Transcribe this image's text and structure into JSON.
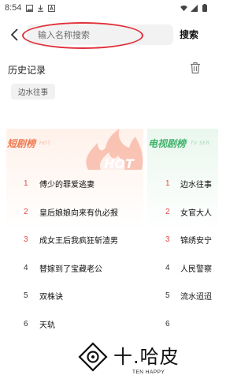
{
  "status_bar": {
    "time": "8:54",
    "icons": [
      "image-icon",
      "download-icon",
      "font-icon",
      "wifi-icon",
      "signal-icon",
      "battery-icon"
    ]
  },
  "search": {
    "placeholder": "输入名称搜索",
    "button_label": "搜索",
    "annotation_color": "#e0303a"
  },
  "history": {
    "title": "历史记录",
    "items": [
      "边水往事"
    ]
  },
  "short_drama_ranking": {
    "title": "短剧榜",
    "subtitle": "HOT",
    "deco_text": "HOT",
    "accent_color": "#f07850",
    "items": [
      {
        "rank": "1",
        "name": "傅少的罪爱逃妻"
      },
      {
        "rank": "2",
        "name": "皇后娘娘向来有仇必报"
      },
      {
        "rank": "3",
        "name": "成女王后我疯狂斩渣男"
      },
      {
        "rank": "4",
        "name": "替嫁到了宝藏老公"
      },
      {
        "rank": "5",
        "name": "双株诀"
      },
      {
        "rank": "6",
        "name": "天轨"
      }
    ]
  },
  "tv_ranking": {
    "title": "电视剧榜",
    "subtitle": "TV SER",
    "accent_color": "#3fb26a",
    "items": [
      {
        "rank": "1",
        "name": "边水往事"
      },
      {
        "rank": "2",
        "name": "女官大人"
      },
      {
        "rank": "3",
        "name": "锦绣安宁"
      },
      {
        "rank": "4",
        "name": "人民警察"
      },
      {
        "rank": "5",
        "name": "流水迢迢"
      },
      {
        "rank": "6",
        "name": ""
      }
    ]
  },
  "watermark": {
    "brand": "十.哈皮",
    "tagline": "TEN HAPPY"
  }
}
